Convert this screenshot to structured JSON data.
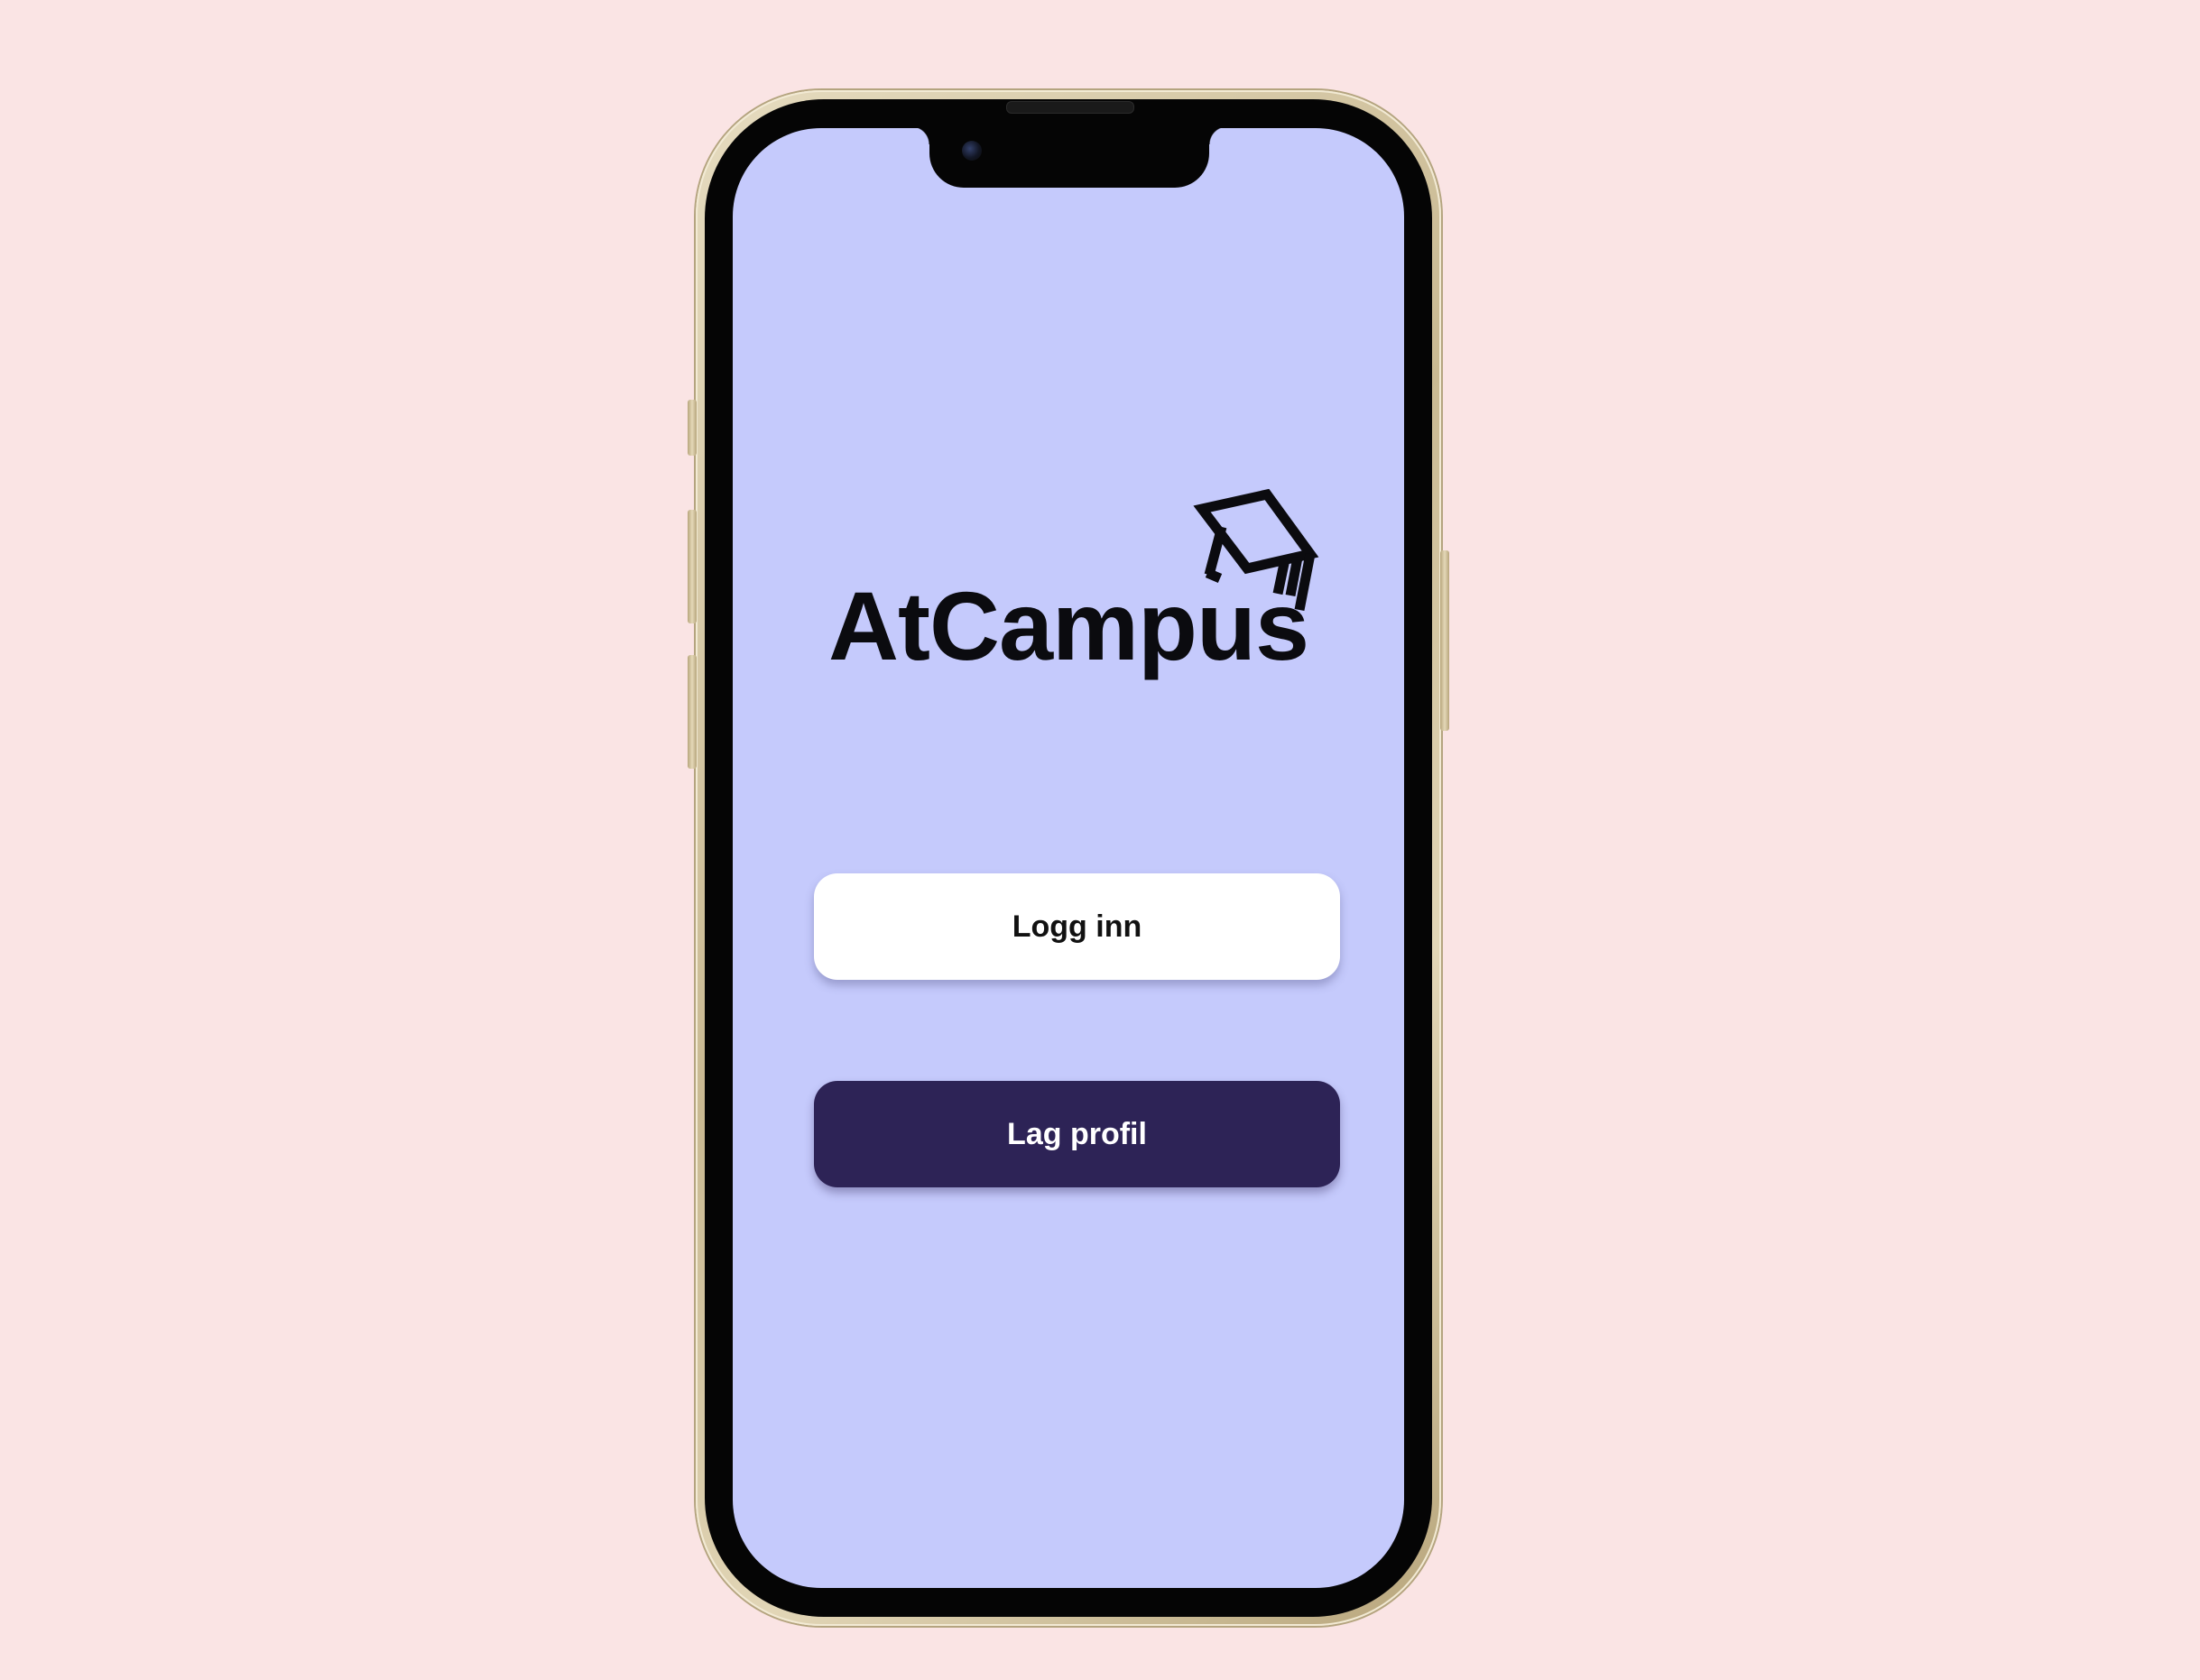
{
  "app": {
    "name": "AtCampus",
    "logo_icon": "graduation-cap-icon"
  },
  "actions": {
    "login_label": "Logg inn",
    "signup_label": "Lag profil"
  },
  "colors": {
    "page_background": "#fae4e4",
    "screen_background": "#c5cafc",
    "login_button_background": "#ffffff",
    "signup_button_background": "#2d2356",
    "logo_color": "#0b0b0f"
  }
}
